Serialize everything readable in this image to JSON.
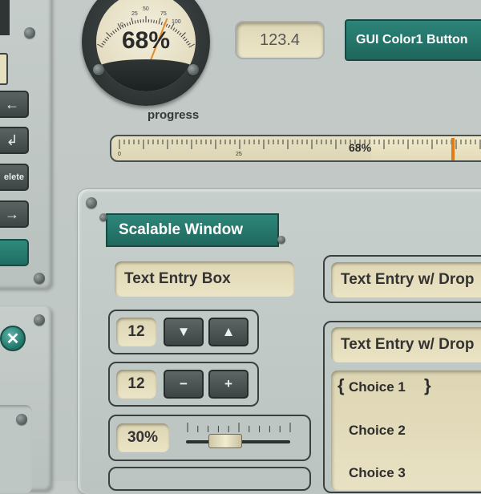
{
  "gauge": {
    "value_text": "68%",
    "value": 68,
    "scale_labels": [
      "0",
      "25",
      "50",
      "75",
      "100"
    ],
    "label": "progress"
  },
  "readout": {
    "value": "123.4"
  },
  "color_button": {
    "label": "GUI Color1 Button"
  },
  "ruler": {
    "value_text": "68%",
    "value": 0.68,
    "scale_labels": [
      "0",
      "25"
    ]
  },
  "left_panel": {
    "buttons": [
      {
        "label": "←",
        "icon": "arrow-left-icon"
      },
      {
        "label": "↲",
        "icon": "return-icon"
      },
      {
        "label": "elete",
        "icon": ""
      },
      {
        "label": "→",
        "icon": "arrow-right-icon"
      },
      {
        "label": "",
        "icon": ""
      }
    ],
    "close_glyph": "✕"
  },
  "window": {
    "title": "Scalable Window",
    "text_entry": "Text Entry Box",
    "dropdown1": "Text Entry w/ Drop",
    "dropdown2": "Text Entry w/ Drop",
    "spinner1": {
      "value": "12",
      "down": "▼",
      "up": "▲"
    },
    "spinner2": {
      "value": "12",
      "minus": "−",
      "plus": "+"
    },
    "slider": {
      "value_text": "30%",
      "value": 0.3
    },
    "choices": [
      "Choice 1",
      "Choice 2",
      "Choice 3"
    ],
    "braces": [
      "{",
      "}"
    ]
  },
  "colors": {
    "accent_teal": "#2a7e72",
    "cream": "#e7e0c0",
    "panel": "#c3cac8",
    "dark_button": "#4a5252",
    "marker": "#e07a1a"
  }
}
